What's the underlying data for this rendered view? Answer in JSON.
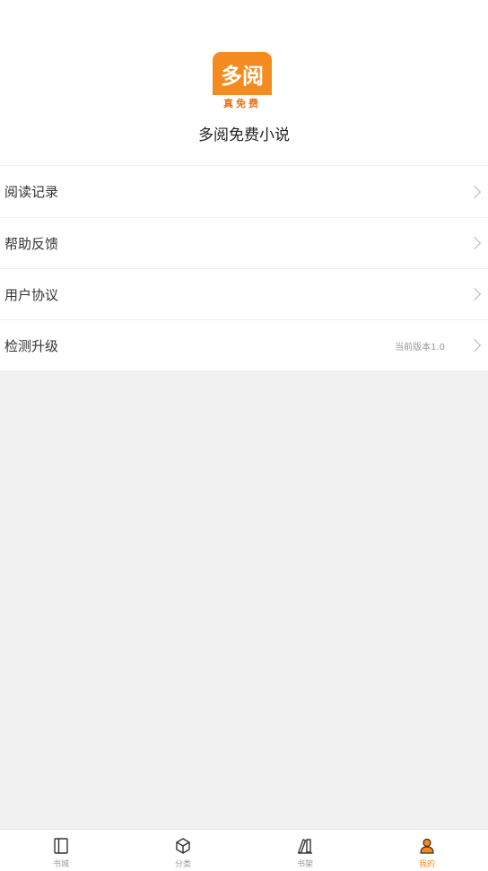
{
  "app": {
    "name": "多阅免费小说",
    "logo_main": "多阅",
    "logo_sub": "真免费"
  },
  "menu": [
    {
      "label": "阅读记录",
      "extra": ""
    },
    {
      "label": "帮助反馈",
      "extra": ""
    },
    {
      "label": "用户协议",
      "extra": ""
    },
    {
      "label": "检测升级",
      "extra": "当前版本1.0"
    }
  ],
  "tabs": [
    {
      "label": "书城",
      "icon": "book-icon",
      "active": false
    },
    {
      "label": "分类",
      "icon": "cube-icon",
      "active": false
    },
    {
      "label": "书架",
      "icon": "bookshelf-icon",
      "active": false
    },
    {
      "label": "我的",
      "icon": "user-icon",
      "active": true
    }
  ],
  "colors": {
    "accent": "#f58b1f",
    "background": "#f1f1f1"
  }
}
